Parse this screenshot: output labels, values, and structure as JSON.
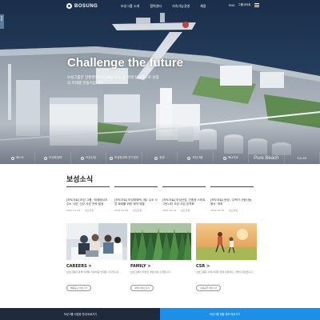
{
  "header": {
    "logo": "BOSUNG",
    "nav": [
      "보성그룹 소개",
      "협력센터",
      "지속가능경영",
      "채용"
    ],
    "util_lang": "ENG",
    "util_group": "그룹사이트"
  },
  "hero": {
    "side_tab": "KOR",
    "title": "Challenge the future",
    "subtitle": "보성그룹은 친환경에너지·LNG·수소 등 미래 신사업으로 성장의 미래를 만들어갑니다"
  },
  "quick_links": [
    {
      "label": "에너지",
      "big": false
    },
    {
      "label": "보성파워텍",
      "big": false
    },
    {
      "label": "보성산업",
      "big": false
    },
    {
      "label": "보성파워텍 연구센터",
      "big": false
    },
    {
      "label": "한양",
      "big": false
    },
    {
      "label": "보성그룹",
      "big": false
    },
    {
      "label": "에너지로",
      "big": false
    },
    {
      "label": "Pure Beach",
      "big": true
    },
    {
      "label": "SOLAR",
      "big": false
    }
  ],
  "news": {
    "heading": "보성소식",
    "items": [
      {
        "text": "[보도자료] 보성 그룹, '미래에너지 수소 사업' 신규 사업 전략 발표",
        "date": "2022.11.24",
        "source": "보도자료"
      },
      {
        "text": "[보도자료] 보성파워텍, 제2 수소 사업 확대를 위한 계약 체결",
        "date": "2022.11.08",
        "source": "보도자료"
      },
      {
        "text": "[보도자료] 보성산업, 친환경 스마트 그린시티 조성 사업 본격화",
        "date": "2022.10.14",
        "source": "보도자료"
      },
      {
        "text": "[보도자료] 한양, '주택가 사랑나눔 봉사' 개최",
        "date": "2022.09.30",
        "source": "보도자료"
      }
    ]
  },
  "cards": [
    {
      "title": "CAREERS >",
      "desc": "보성그룹과 함께 미래를 이끌어갈 인재를 기다립니다",
      "button": "채용공고 바로가기"
    },
    {
      "title": "FAMILY >",
      "desc": "보성그룹의 다양한 계열사를 소개합니다",
      "button": "계열사 바로가기"
    },
    {
      "title": "CSR >",
      "desc": "보성그룹은 지역사회와 함께 성장하는 기업이 되겠습니다",
      "button": "사회공헌 바로가기"
    }
  ],
  "footer_band": {
    "left": "보성그룹 사업장 안내 바로가기",
    "right": "보성그룹 채용 정보 바로가기"
  },
  "colors": {
    "accent_blue": "#1e8fe6",
    "dark_navy": "#1f2a3d"
  }
}
